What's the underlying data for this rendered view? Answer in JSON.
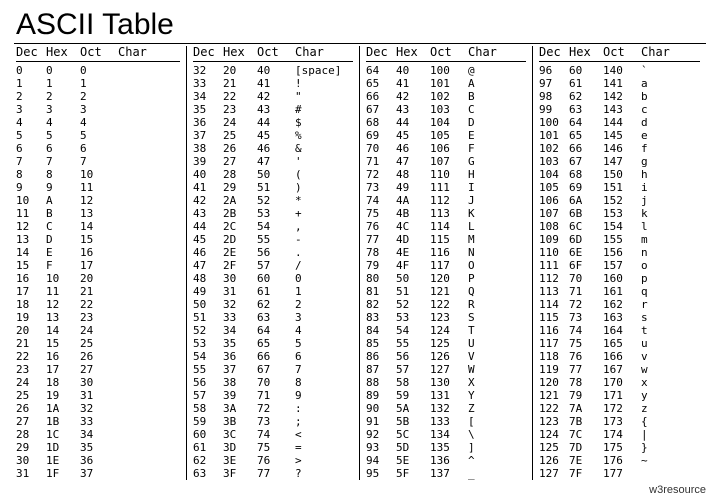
{
  "title": "ASCII Table",
  "footer": "w3resource",
  "headers": [
    "Dec",
    "Hex",
    "Oct",
    "Char"
  ],
  "columns": [
    {
      "rows": [
        {
          "dec": "0",
          "hex": "0",
          "oct": "0",
          "char": ""
        },
        {
          "dec": "1",
          "hex": "1",
          "oct": "1",
          "char": ""
        },
        {
          "dec": "2",
          "hex": "2",
          "oct": "2",
          "char": ""
        },
        {
          "dec": "3",
          "hex": "3",
          "oct": "3",
          "char": ""
        },
        {
          "dec": "4",
          "hex": "4",
          "oct": "4",
          "char": ""
        },
        {
          "dec": "5",
          "hex": "5",
          "oct": "5",
          "char": ""
        },
        {
          "dec": "6",
          "hex": "6",
          "oct": "6",
          "char": ""
        },
        {
          "dec": "7",
          "hex": "7",
          "oct": "7",
          "char": ""
        },
        {
          "dec": "8",
          "hex": "8",
          "oct": "10",
          "char": ""
        },
        {
          "dec": "9",
          "hex": "9",
          "oct": "11",
          "char": ""
        },
        {
          "dec": "10",
          "hex": "A",
          "oct": "12",
          "char": ""
        },
        {
          "dec": "11",
          "hex": "B",
          "oct": "13",
          "char": ""
        },
        {
          "dec": "12",
          "hex": "C",
          "oct": "14",
          "char": ""
        },
        {
          "dec": "13",
          "hex": "D",
          "oct": "15",
          "char": ""
        },
        {
          "dec": "14",
          "hex": "E",
          "oct": "16",
          "char": ""
        },
        {
          "dec": "15",
          "hex": "F",
          "oct": "17",
          "char": ""
        },
        {
          "dec": "16",
          "hex": "10",
          "oct": "20",
          "char": ""
        },
        {
          "dec": "17",
          "hex": "11",
          "oct": "21",
          "char": ""
        },
        {
          "dec": "18",
          "hex": "12",
          "oct": "22",
          "char": ""
        },
        {
          "dec": "19",
          "hex": "13",
          "oct": "23",
          "char": ""
        },
        {
          "dec": "20",
          "hex": "14",
          "oct": "24",
          "char": ""
        },
        {
          "dec": "21",
          "hex": "15",
          "oct": "25",
          "char": ""
        },
        {
          "dec": "22",
          "hex": "16",
          "oct": "26",
          "char": ""
        },
        {
          "dec": "23",
          "hex": "17",
          "oct": "27",
          "char": ""
        },
        {
          "dec": "24",
          "hex": "18",
          "oct": "30",
          "char": ""
        },
        {
          "dec": "25",
          "hex": "19",
          "oct": "31",
          "char": ""
        },
        {
          "dec": "26",
          "hex": "1A",
          "oct": "32",
          "char": ""
        },
        {
          "dec": "27",
          "hex": "1B",
          "oct": "33",
          "char": ""
        },
        {
          "dec": "28",
          "hex": "1C",
          "oct": "34",
          "char": ""
        },
        {
          "dec": "29",
          "hex": "1D",
          "oct": "35",
          "char": ""
        },
        {
          "dec": "30",
          "hex": "1E",
          "oct": "36",
          "char": ""
        },
        {
          "dec": "31",
          "hex": "1F",
          "oct": "37",
          "char": ""
        }
      ]
    },
    {
      "rows": [
        {
          "dec": "32",
          "hex": "20",
          "oct": "40",
          "char": "[space]"
        },
        {
          "dec": "33",
          "hex": "21",
          "oct": "41",
          "char": "!"
        },
        {
          "dec": "34",
          "hex": "22",
          "oct": "42",
          "char": "\""
        },
        {
          "dec": "35",
          "hex": "23",
          "oct": "43",
          "char": "#"
        },
        {
          "dec": "36",
          "hex": "24",
          "oct": "44",
          "char": "$"
        },
        {
          "dec": "37",
          "hex": "25",
          "oct": "45",
          "char": "%"
        },
        {
          "dec": "38",
          "hex": "26",
          "oct": "46",
          "char": "&"
        },
        {
          "dec": "39",
          "hex": "27",
          "oct": "47",
          "char": "'"
        },
        {
          "dec": "40",
          "hex": "28",
          "oct": "50",
          "char": "("
        },
        {
          "dec": "41",
          "hex": "29",
          "oct": "51",
          "char": ")"
        },
        {
          "dec": "42",
          "hex": "2A",
          "oct": "52",
          "char": "*"
        },
        {
          "dec": "43",
          "hex": "2B",
          "oct": "53",
          "char": "+"
        },
        {
          "dec": "44",
          "hex": "2C",
          "oct": "54",
          "char": ","
        },
        {
          "dec": "45",
          "hex": "2D",
          "oct": "55",
          "char": "-"
        },
        {
          "dec": "46",
          "hex": "2E",
          "oct": "56",
          "char": "."
        },
        {
          "dec": "47",
          "hex": "2F",
          "oct": "57",
          "char": "/"
        },
        {
          "dec": "48",
          "hex": "30",
          "oct": "60",
          "char": "0"
        },
        {
          "dec": "49",
          "hex": "31",
          "oct": "61",
          "char": "1"
        },
        {
          "dec": "50",
          "hex": "32",
          "oct": "62",
          "char": "2"
        },
        {
          "dec": "51",
          "hex": "33",
          "oct": "63",
          "char": "3"
        },
        {
          "dec": "52",
          "hex": "34",
          "oct": "64",
          "char": "4"
        },
        {
          "dec": "53",
          "hex": "35",
          "oct": "65",
          "char": "5"
        },
        {
          "dec": "54",
          "hex": "36",
          "oct": "66",
          "char": "6"
        },
        {
          "dec": "55",
          "hex": "37",
          "oct": "67",
          "char": "7"
        },
        {
          "dec": "56",
          "hex": "38",
          "oct": "70",
          "char": "8"
        },
        {
          "dec": "57",
          "hex": "39",
          "oct": "71",
          "char": "9"
        },
        {
          "dec": "58",
          "hex": "3A",
          "oct": "72",
          "char": ":"
        },
        {
          "dec": "59",
          "hex": "3B",
          "oct": "73",
          "char": ";"
        },
        {
          "dec": "60",
          "hex": "3C",
          "oct": "74",
          "char": "<"
        },
        {
          "dec": "61",
          "hex": "3D",
          "oct": "75",
          "char": "="
        },
        {
          "dec": "62",
          "hex": "3E",
          "oct": "76",
          "char": ">"
        },
        {
          "dec": "63",
          "hex": "3F",
          "oct": "77",
          "char": "?"
        }
      ]
    },
    {
      "rows": [
        {
          "dec": "64",
          "hex": "40",
          "oct": "100",
          "char": "@"
        },
        {
          "dec": "65",
          "hex": "41",
          "oct": "101",
          "char": "A"
        },
        {
          "dec": "66",
          "hex": "42",
          "oct": "102",
          "char": "B"
        },
        {
          "dec": "67",
          "hex": "43",
          "oct": "103",
          "char": "C"
        },
        {
          "dec": "68",
          "hex": "44",
          "oct": "104",
          "char": "D"
        },
        {
          "dec": "69",
          "hex": "45",
          "oct": "105",
          "char": "E"
        },
        {
          "dec": "70",
          "hex": "46",
          "oct": "106",
          "char": "F"
        },
        {
          "dec": "71",
          "hex": "47",
          "oct": "107",
          "char": "G"
        },
        {
          "dec": "72",
          "hex": "48",
          "oct": "110",
          "char": "H"
        },
        {
          "dec": "73",
          "hex": "49",
          "oct": "111",
          "char": "I"
        },
        {
          "dec": "74",
          "hex": "4A",
          "oct": "112",
          "char": "J"
        },
        {
          "dec": "75",
          "hex": "4B",
          "oct": "113",
          "char": "K"
        },
        {
          "dec": "76",
          "hex": "4C",
          "oct": "114",
          "char": "L"
        },
        {
          "dec": "77",
          "hex": "4D",
          "oct": "115",
          "char": "M"
        },
        {
          "dec": "78",
          "hex": "4E",
          "oct": "116",
          "char": "N"
        },
        {
          "dec": "79",
          "hex": "4F",
          "oct": "117",
          "char": "O"
        },
        {
          "dec": "80",
          "hex": "50",
          "oct": "120",
          "char": "P"
        },
        {
          "dec": "81",
          "hex": "51",
          "oct": "121",
          "char": "Q"
        },
        {
          "dec": "82",
          "hex": "52",
          "oct": "122",
          "char": "R"
        },
        {
          "dec": "83",
          "hex": "53",
          "oct": "123",
          "char": "S"
        },
        {
          "dec": "84",
          "hex": "54",
          "oct": "124",
          "char": "T"
        },
        {
          "dec": "85",
          "hex": "55",
          "oct": "125",
          "char": "U"
        },
        {
          "dec": "86",
          "hex": "56",
          "oct": "126",
          "char": "V"
        },
        {
          "dec": "87",
          "hex": "57",
          "oct": "127",
          "char": "W"
        },
        {
          "dec": "88",
          "hex": "58",
          "oct": "130",
          "char": "X"
        },
        {
          "dec": "89",
          "hex": "59",
          "oct": "131",
          "char": "Y"
        },
        {
          "dec": "90",
          "hex": "5A",
          "oct": "132",
          "char": "Z"
        },
        {
          "dec": "91",
          "hex": "5B",
          "oct": "133",
          "char": "["
        },
        {
          "dec": "92",
          "hex": "5C",
          "oct": "134",
          "char": "\\"
        },
        {
          "dec": "93",
          "hex": "5D",
          "oct": "135",
          "char": "]"
        },
        {
          "dec": "94",
          "hex": "5E",
          "oct": "136",
          "char": "^"
        },
        {
          "dec": "95",
          "hex": "5F",
          "oct": "137",
          "char": "_"
        }
      ]
    },
    {
      "rows": [
        {
          "dec": "96",
          "hex": "60",
          "oct": "140",
          "char": "`"
        },
        {
          "dec": "97",
          "hex": "61",
          "oct": "141",
          "char": "a"
        },
        {
          "dec": "98",
          "hex": "62",
          "oct": "142",
          "char": "b"
        },
        {
          "dec": "99",
          "hex": "63",
          "oct": "143",
          "char": "c"
        },
        {
          "dec": "100",
          "hex": "64",
          "oct": "144",
          "char": "d"
        },
        {
          "dec": "101",
          "hex": "65",
          "oct": "145",
          "char": "e"
        },
        {
          "dec": "102",
          "hex": "66",
          "oct": "146",
          "char": "f"
        },
        {
          "dec": "103",
          "hex": "67",
          "oct": "147",
          "char": "g"
        },
        {
          "dec": "104",
          "hex": "68",
          "oct": "150",
          "char": "h"
        },
        {
          "dec": "105",
          "hex": "69",
          "oct": "151",
          "char": "i"
        },
        {
          "dec": "106",
          "hex": "6A",
          "oct": "152",
          "char": "j"
        },
        {
          "dec": "107",
          "hex": "6B",
          "oct": "153",
          "char": "k"
        },
        {
          "dec": "108",
          "hex": "6C",
          "oct": "154",
          "char": "l"
        },
        {
          "dec": "109",
          "hex": "6D",
          "oct": "155",
          "char": "m"
        },
        {
          "dec": "110",
          "hex": "6E",
          "oct": "156",
          "char": "n"
        },
        {
          "dec": "111",
          "hex": "6F",
          "oct": "157",
          "char": "o"
        },
        {
          "dec": "112",
          "hex": "70",
          "oct": "160",
          "char": "p"
        },
        {
          "dec": "113",
          "hex": "71",
          "oct": "161",
          "char": "q"
        },
        {
          "dec": "114",
          "hex": "72",
          "oct": "162",
          "char": "r"
        },
        {
          "dec": "115",
          "hex": "73",
          "oct": "163",
          "char": "s"
        },
        {
          "dec": "116",
          "hex": "74",
          "oct": "164",
          "char": "t"
        },
        {
          "dec": "117",
          "hex": "75",
          "oct": "165",
          "char": "u"
        },
        {
          "dec": "118",
          "hex": "76",
          "oct": "166",
          "char": "v"
        },
        {
          "dec": "119",
          "hex": "77",
          "oct": "167",
          "char": "w"
        },
        {
          "dec": "120",
          "hex": "78",
          "oct": "170",
          "char": "x"
        },
        {
          "dec": "121",
          "hex": "79",
          "oct": "171",
          "char": "y"
        },
        {
          "dec": "122",
          "hex": "7A",
          "oct": "172",
          "char": "z"
        },
        {
          "dec": "123",
          "hex": "7B",
          "oct": "173",
          "char": "{"
        },
        {
          "dec": "124",
          "hex": "7C",
          "oct": "174",
          "char": "|"
        },
        {
          "dec": "125",
          "hex": "7D",
          "oct": "175",
          "char": "}"
        },
        {
          "dec": "126",
          "hex": "7E",
          "oct": "176",
          "char": "~"
        },
        {
          "dec": "127",
          "hex": "7F",
          "oct": "177",
          "char": ""
        }
      ]
    }
  ]
}
